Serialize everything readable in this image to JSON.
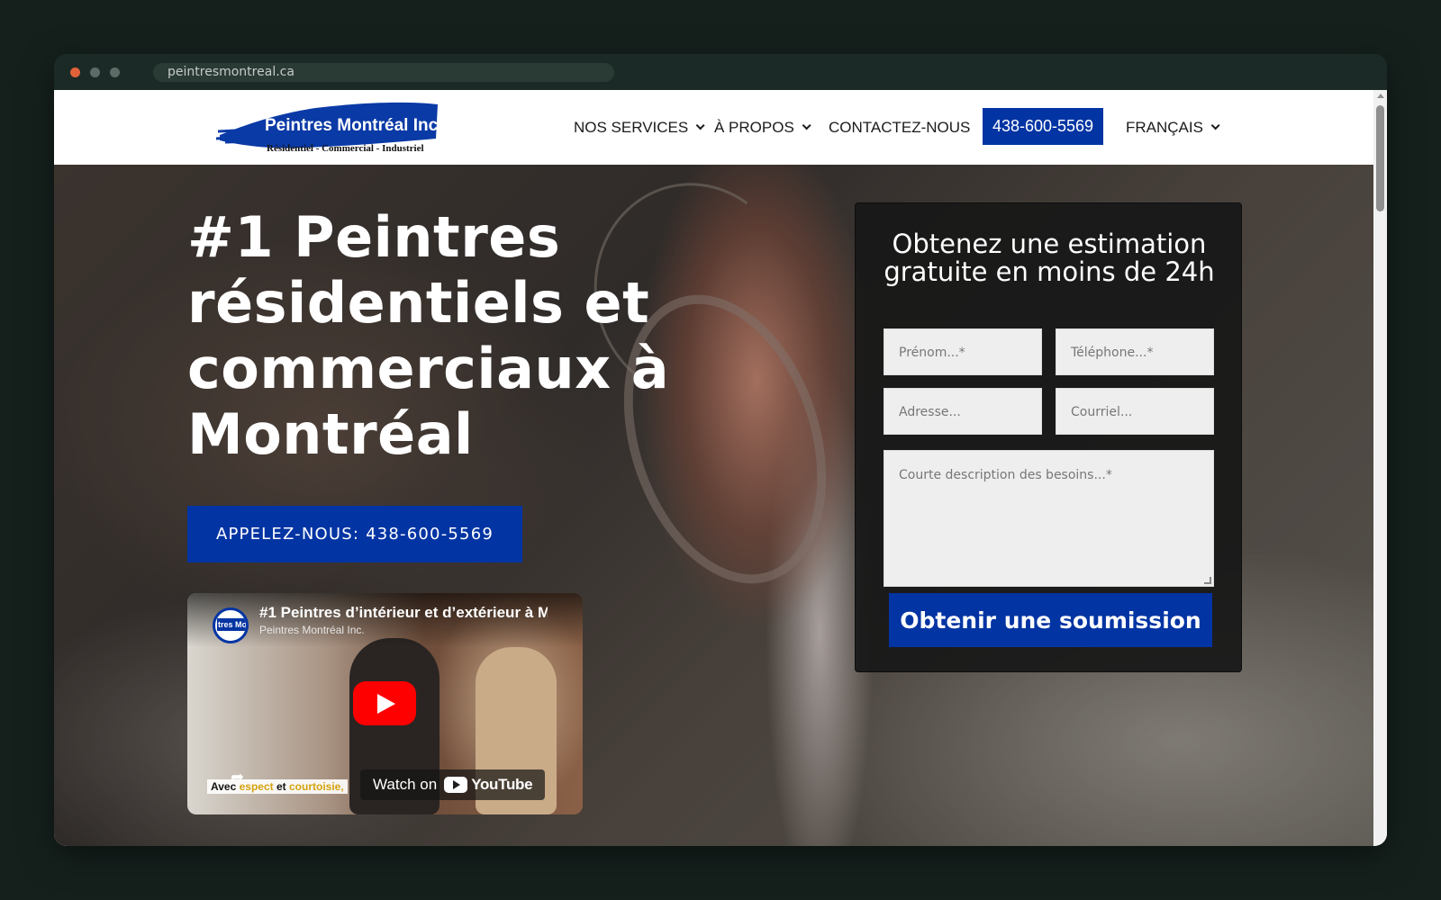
{
  "browser": {
    "url": "peintresmontreal.ca"
  },
  "header": {
    "logo": {
      "name": "Peintres Montréal Inc.",
      "tagline": "Résidentiel - Commercial - Industriel"
    },
    "nav": [
      {
        "label": "NOS SERVICES",
        "has_dropdown": true
      },
      {
        "label": "À PROPOS",
        "has_dropdown": true
      },
      {
        "label": "CONTACTEZ-NOUS",
        "has_dropdown": false
      }
    ],
    "phone": "438-600-5569",
    "language": "FRANÇAIS"
  },
  "hero": {
    "title": "#1 Peintres résidentiels et commerciaux à Montréal",
    "cta_label": "APPELEZ-NOUS: 438-600-5569"
  },
  "video": {
    "title": "#1 Peintres d’intérieur et d’extérieur à M",
    "channel": "Peintres Montréal Inc.",
    "avatar_text": "tres Mo",
    "caption_part1": "Avec",
    "caption_part2": "espect",
    "caption_part3": "et",
    "caption_part4": "courtoisie,",
    "watch_label": "Watch on",
    "youtube_label": "YouTube"
  },
  "form": {
    "title": "Obtenez une estimation gratuite en moins de 24h",
    "fields": {
      "first_name": "Prénom...*",
      "phone": "Téléphone...*",
      "address": "Adresse...",
      "email": "Courriel...",
      "description": "Courte description des besoins...*"
    },
    "submit_label": "Obtenir une soumission"
  },
  "colors": {
    "brand_blue": "#0334a3",
    "youtube_red": "#ff0000"
  }
}
